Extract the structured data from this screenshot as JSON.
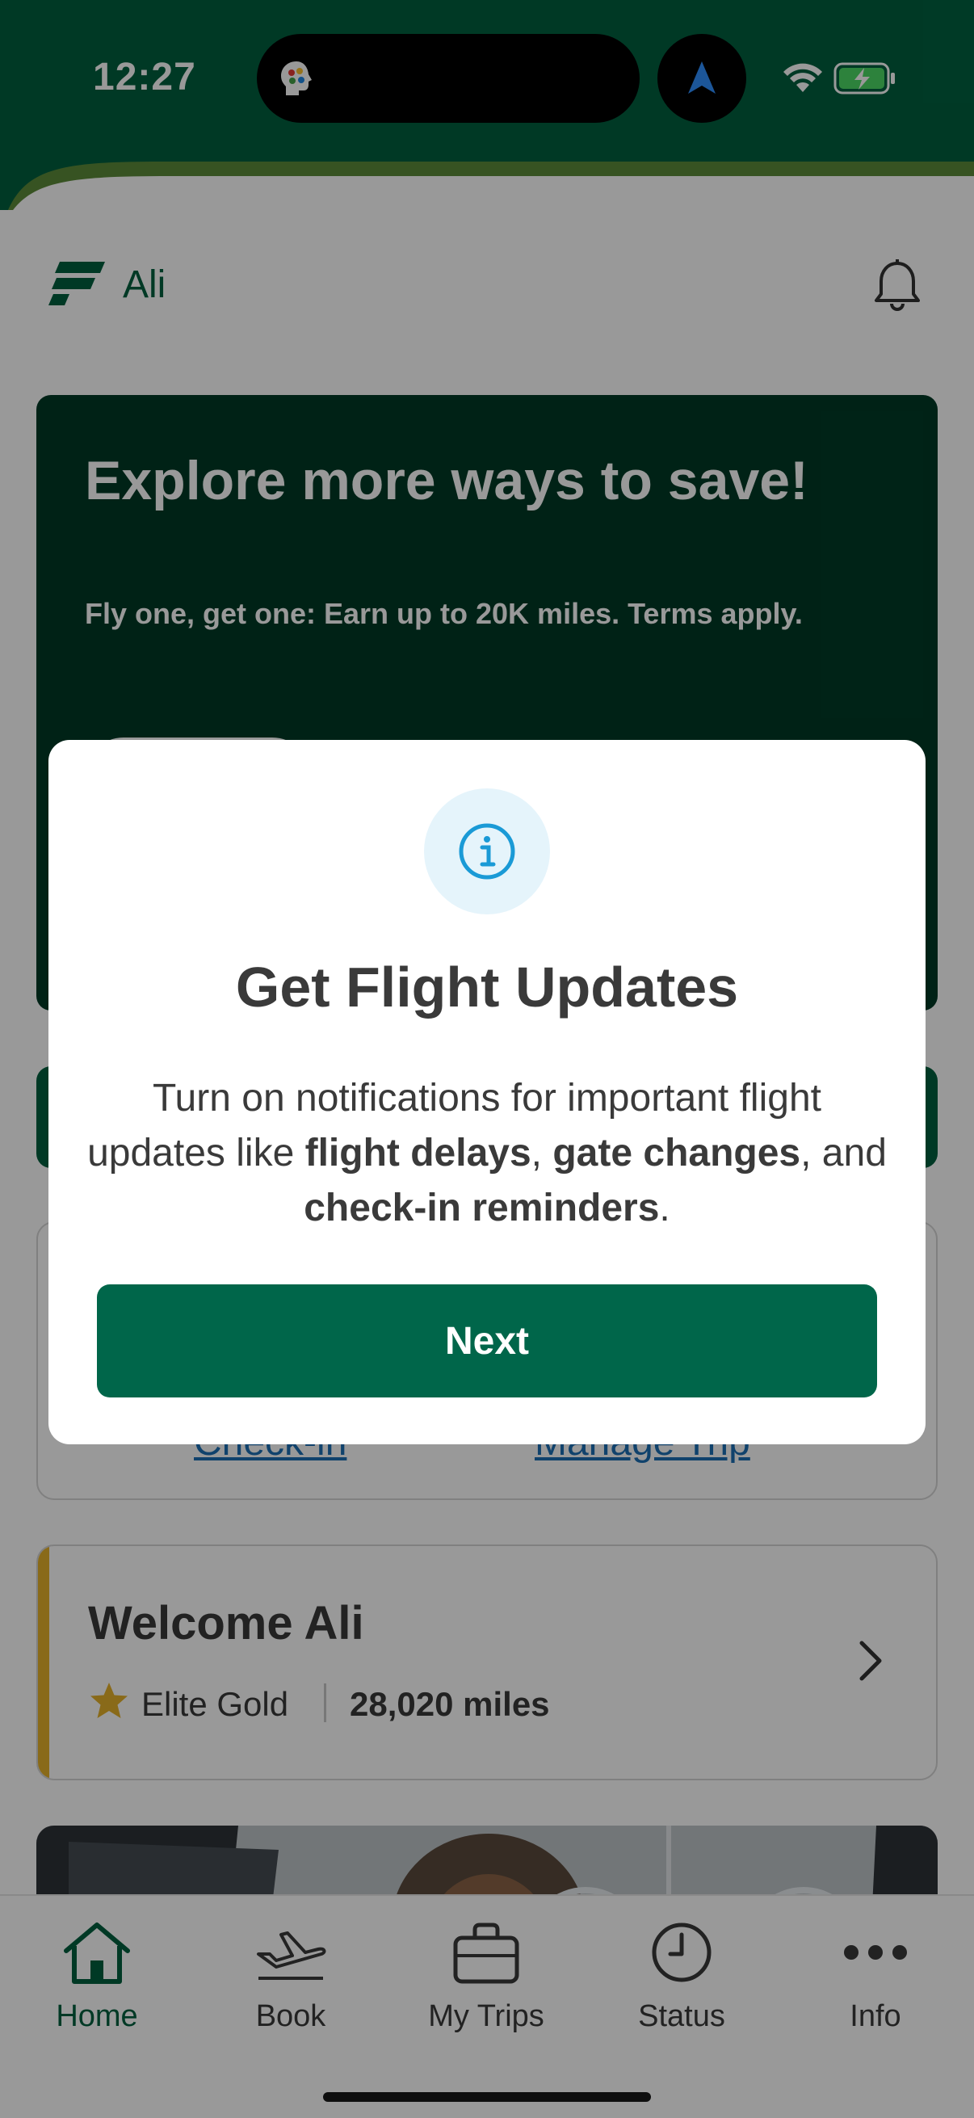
{
  "status_bar": {
    "time": "12:27"
  },
  "header": {
    "user_name": "Ali"
  },
  "promo": {
    "title": "Explore more ways to save!",
    "subtitle": "Fly one, get one: Earn up to 20K miles. Terms apply."
  },
  "trip": {
    "check_in_label": "Check-in",
    "manage_trip_label": "Manage Trip"
  },
  "welcome": {
    "title": "Welcome Ali",
    "tier": "Elite Gold",
    "miles": "28,020 miles"
  },
  "tabs": [
    {
      "label": "Home",
      "icon": "home-icon"
    },
    {
      "label": "Book",
      "icon": "plane-icon"
    },
    {
      "label": "My Trips",
      "icon": "briefcase-icon"
    },
    {
      "label": "Status",
      "icon": "clock-icon"
    },
    {
      "label": "Info",
      "icon": "more-icon"
    }
  ],
  "modal": {
    "title": "Get Flight Updates",
    "body_part1": "Turn on notifications for important flight updates like ",
    "body_bold1": "flight delays",
    "body_sep1": ", ",
    "body_bold2": "gate changes",
    "body_sep2": ", and ",
    "body_bold3": "check-in reminders",
    "body_end": ".",
    "next_label": "Next"
  },
  "colors": {
    "brand_green": "#00603f",
    "button_green": "#00664a",
    "gold": "#e5b12a",
    "link_blue": "#1b6fb5",
    "info_blue": "#1a9ad6"
  }
}
